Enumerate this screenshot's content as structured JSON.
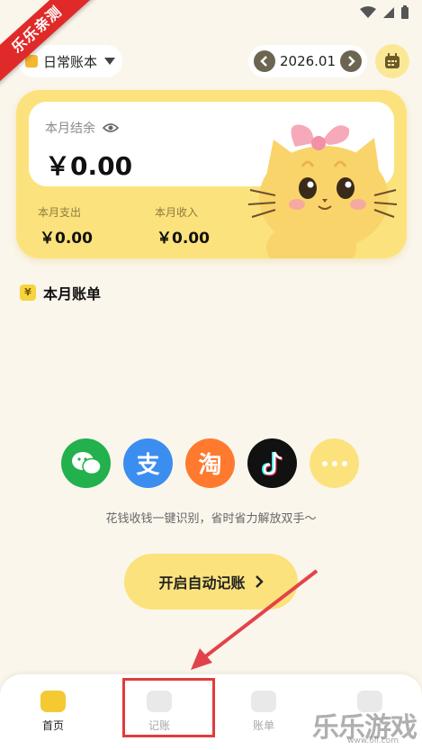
{
  "ribbon": "乐乐亲测",
  "header": {
    "book_name": "日常账本",
    "date": "2026.01"
  },
  "card": {
    "balance_label": "本月结余",
    "balance_value": "￥0.00",
    "expense_label": "本月支出",
    "expense_value": "￥0.00",
    "income_label": "本月收入",
    "income_value": "￥0.00"
  },
  "section": {
    "title": "本月账单",
    "icon_text": "¥"
  },
  "apps": [
    {
      "name": "wechat",
      "color": "#22B14C"
    },
    {
      "name": "alipay",
      "color": "#3C8DF0",
      "glyph": "支"
    },
    {
      "name": "taobao",
      "color": "#FF7A2E",
      "glyph": "淘"
    },
    {
      "name": "douyin",
      "color": "#111111"
    },
    {
      "name": "more",
      "color": "#FCE27C"
    }
  ],
  "hint": "花钱收钱一键识别，省时省力解放双手～",
  "auto_button": "开启自动记账",
  "tabs": [
    {
      "label": "首页"
    },
    {
      "label": "记账"
    },
    {
      "label": "账单"
    },
    {
      "label": ""
    }
  ],
  "watermark": {
    "brand": "乐乐游戏",
    "url": "www.6ll.com"
  }
}
